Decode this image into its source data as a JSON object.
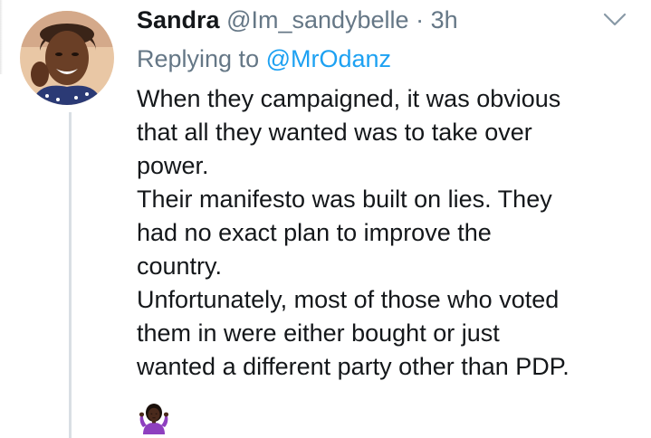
{
  "tweet": {
    "author_name": "Sandra",
    "author_handle": "@Im_sandybelle",
    "separator": "·",
    "timestamp": "3h",
    "replying_prefix": "Replying to",
    "replying_handle": "@MrOdanz",
    "lines": [
      "When they campaigned, it was obvious",
      "that all they wanted was to take over",
      "power.",
      "Their manifesto was built on lies. They",
      "had no exact plan to improve the",
      "country.",
      "Unfortunately, most of those who voted",
      "them in were either bought or just",
      "wanted a different party other than PDP."
    ],
    "emoji": "person-shrugging-emoji",
    "icons": {
      "avatar": "profile-photo",
      "menu": "chevron-down-icon"
    }
  },
  "colors": {
    "text": "#14171a",
    "secondary": "#657786",
    "link": "#1da1f2",
    "thread_line": "#d9dfe4"
  }
}
